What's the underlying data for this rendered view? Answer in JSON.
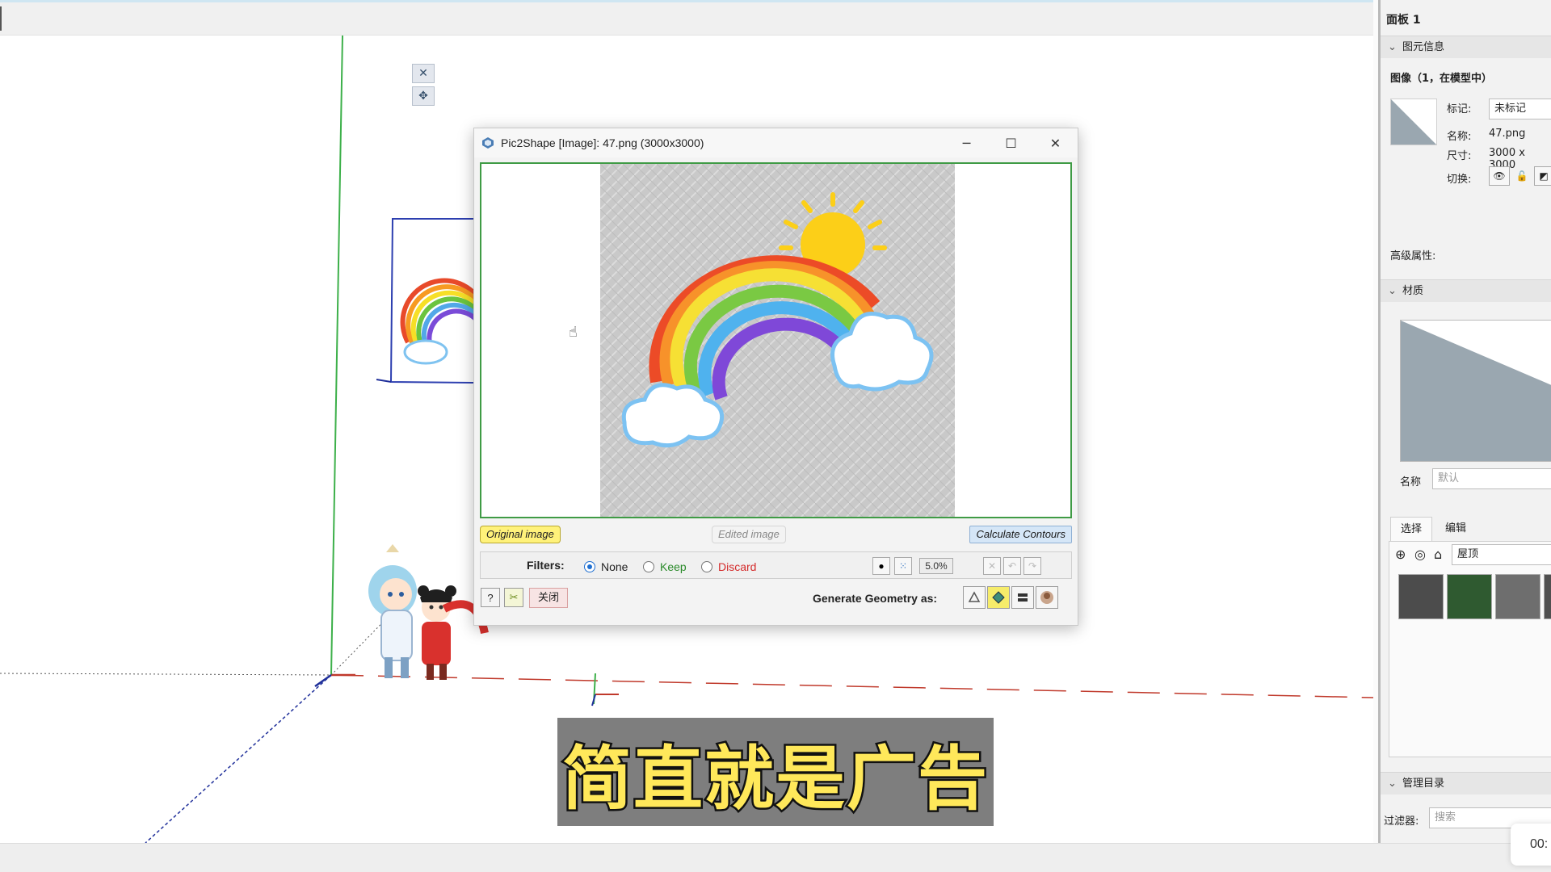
{
  "dialog": {
    "title": "Pic2Shape [Image]: 47.png (3000x3000)",
    "tabs": {
      "original": "Original image",
      "edited": "Edited image",
      "calculate": "Calculate Contours"
    },
    "filters": {
      "label": "Filters:",
      "options": [
        "None",
        "Keep",
        "Discard"
      ],
      "selected": "None",
      "percent": "5.0%"
    },
    "close_label": "关闭",
    "generate_label": "Generate Geometry as:"
  },
  "panel": {
    "title": "面板 1",
    "entity_info": {
      "header": "图元信息",
      "type": "图像（1，在模型中）",
      "tag_label": "标记:",
      "tag_value": "未标记",
      "name_label": "名称:",
      "name_value": "47.png",
      "size_label": "尺寸:",
      "size_value": "3000 x 3000",
      "toggle_label": "切换:",
      "advanced_label": "高级属性:"
    },
    "material": {
      "header": "材质",
      "name_label": "名称",
      "name_placeholder": "默认",
      "tab_select": "选择",
      "tab_edit": "编辑",
      "library_value": "屋顶"
    },
    "outliner": {
      "header": "管理目录",
      "filter_label": "过滤器:",
      "filter_placeholder": "搜索"
    }
  },
  "timer": "00:",
  "subtitle": "简直就是广告",
  "colors": {
    "accent_green": "#3f9b45",
    "original_tab": "#fff27a",
    "subtitle_text": "#ffe85a"
  }
}
